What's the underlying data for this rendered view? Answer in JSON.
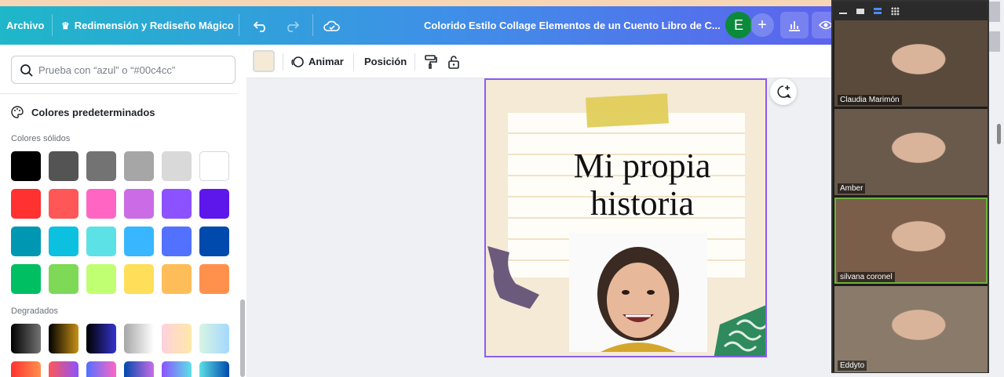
{
  "topbar": {
    "file_label": "Archivo",
    "magic_label": "Redimensión y Rediseño Mágico",
    "doc_title": "Colorido Estilo Collage Elementos de un Cuento Libro de C...",
    "avatar_initial": "E",
    "add_label": "+"
  },
  "toolbar": {
    "animate_label": "Animar",
    "position_label": "Posición",
    "current_color": "#f4ead5"
  },
  "color_panel": {
    "search_placeholder": "Prueba con “azul” o “#00c4cc”",
    "section_title": "Colores predeterminados",
    "solid_label": "Colores sólidos",
    "gradient_label": "Degradados",
    "solid_colors": [
      [
        "#000000",
        "#545454",
        "#737373",
        "#a6a6a6",
        "#d9d9d9",
        "#ffffff"
      ],
      [
        "#ff3131",
        "#ff5757",
        "#ff66c4",
        "#cb6ce6",
        "#8c52ff",
        "#5e17eb"
      ],
      [
        "#0097b2",
        "#0cc0df",
        "#5ce1e6",
        "#38b6ff",
        "#5271ff",
        "#004aad"
      ],
      [
        "#00bf63",
        "#7ed957",
        "#c1ff72",
        "#ffde59",
        "#ffbd59",
        "#ff914d"
      ]
    ],
    "gradients": [
      [
        "#000000",
        "#737373"
      ],
      [
        "#000000",
        "#c89116"
      ],
      [
        "#000000",
        "#3533cd"
      ],
      [
        "#a6a6a6",
        "#ffffff"
      ],
      [
        "#ffd1dc",
        "#ffe8a8"
      ],
      [
        "#d7f5e1",
        "#a4d8ff"
      ],
      [
        "#ff3131",
        "#ff914d"
      ],
      [
        "#ff5757",
        "#8c52ff"
      ],
      [
        "#5170ff",
        "#ff66c4"
      ],
      [
        "#004aad",
        "#cb6ce6"
      ],
      [
        "#8c52ff",
        "#5ce1e6"
      ],
      [
        "#5de0e6",
        "#004aad"
      ]
    ]
  },
  "canvas": {
    "title_line1": "Mi propia",
    "title_line2": "historia"
  },
  "call": {
    "participants": [
      {
        "name": "Claudia Marimón",
        "bg": "#5a4a3c"
      },
      {
        "name": "Amber",
        "bg": "#6a5a4c"
      },
      {
        "name": "silvana coronel",
        "bg": "#7a5e4a"
      },
      {
        "name": "Eddyto",
        "bg": "#8a7a6a"
      }
    ]
  }
}
